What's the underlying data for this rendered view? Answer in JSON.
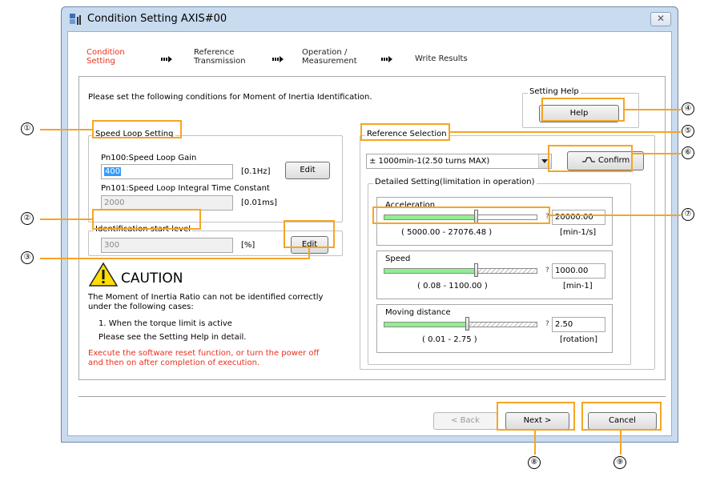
{
  "window": {
    "title": "Condition Setting AXIS#00",
    "close_glyph": "✕"
  },
  "steps": [
    {
      "line1": "Condition",
      "line2": "Setting"
    },
    {
      "line1": "Reference",
      "line2": "Transmission"
    },
    {
      "line1": "Operation /",
      "line2": "Measurement"
    },
    {
      "line1": "Write Results",
      "line2": ""
    }
  ],
  "instructions": "Please set the following conditions for Moment of Inertia Identification.",
  "setting_help": {
    "legend": "Setting Help",
    "button": "Help"
  },
  "speed_loop": {
    "legend": "Speed Loop Setting",
    "gain_label": "Pn100:Speed Loop Gain",
    "gain_value": "400",
    "gain_unit": "[0.1Hz]",
    "edit_label": "Edit",
    "integral_label": "Pn101:Speed Loop Integral Time Constant",
    "integral_value": "2000",
    "integral_unit": "[0.01ms]"
  },
  "identification": {
    "legend": "Identification start level",
    "value": "300",
    "unit": "[%]",
    "edit_label": "Edit"
  },
  "caution": {
    "title": "CAUTION",
    "text1": "The Moment of Inertia Ratio can not be identified correctly",
    "text2": "under the following cases:",
    "item1": "1. When the torque limit is active",
    "item2": "Please see the Setting Help in detail.",
    "warning1": "Execute the software reset function, or turn the power off",
    "warning2": "and then on after completion of execution.",
    "warning_color": "#e8311e"
  },
  "reference": {
    "legend": "Reference Selection",
    "selected": "± 1000min-1(2.50 turns MAX)",
    "confirm_label": "Confirm"
  },
  "detailed": {
    "legend": "Detailed Setting(limitation in operation)",
    "sliders": [
      {
        "label": "Acceleration",
        "value": "20000.00",
        "range": "( 5000.00 - 27076.48 )",
        "unit": "[min-1/s]",
        "qmark": "?",
        "level_pct": 60,
        "hatched": false
      },
      {
        "label": "Speed",
        "value": "1000.00",
        "range": "( 0.08 - 1100.00 )",
        "unit": "[min-1]",
        "qmark": "?",
        "level_pct": 60,
        "hatched": true
      },
      {
        "label": "Moving distance",
        "value": "2.50",
        "range": "( 0.01 - 2.75 )",
        "unit": "[rotation]",
        "qmark": "?",
        "level_pct": 54,
        "hatched": true
      }
    ]
  },
  "footer": {
    "back_label": "< Back",
    "next_label": "Next >",
    "cancel_label": "Cancel"
  },
  "callouts": [
    "①",
    "②",
    "③",
    "④",
    "⑤",
    "⑥",
    "⑦",
    "⑧",
    "⑨"
  ],
  "colors": {
    "highlight": "#f5a524",
    "active_step": "#e8311e",
    "slider_fill": "#90ee90",
    "selection": "#3399ff"
  }
}
